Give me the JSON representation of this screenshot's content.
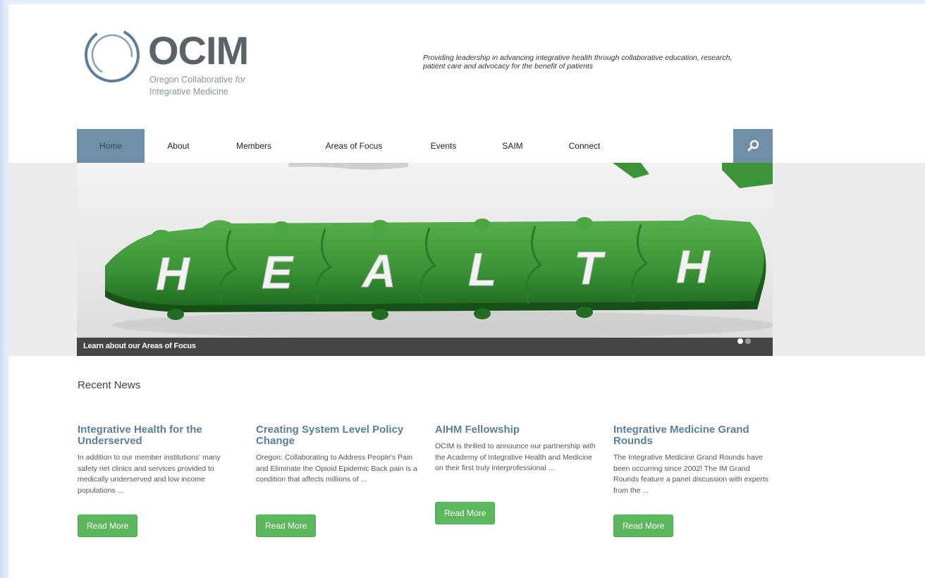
{
  "logo": {
    "mark": "OCIM",
    "line1": "Oregon Collaborative ",
    "line1_italic": "for",
    "line2": "Integrative Medicine"
  },
  "tagline": "Providing leadership in advancing integrative health through collaborative education, research, patient care and advocacy for the benefit of patients",
  "nav": {
    "items": [
      "Home",
      "About",
      "Members",
      "Areas of Focus",
      "Events",
      "SAIM",
      "Connect"
    ],
    "active": "Home",
    "search_icon": "search-icon"
  },
  "slider": {
    "letters": [
      "H",
      "E",
      "A",
      "L",
      "T",
      "H"
    ],
    "caption": "Learn about our Areas of Focus",
    "slide_count": 2,
    "current_slide": 1
  },
  "recent_news": {
    "heading": "Recent News",
    "items": [
      {
        "title": "Integrative Health for the Underserved",
        "excerpt": "In addition to our member institutions' many safety net clinics and services provided to medically underserved and low income populations ...",
        "button": "Read More"
      },
      {
        "title": "Creating System Level Policy Change",
        "excerpt": "Oregon: Collaborating to Address People's Pain and Eliminate the Opioid Epidemic Back pain is a condition that affects millions of ...",
        "button": "Read More"
      },
      {
        "title": "AIHM Fellowship",
        "excerpt": "OCIM is thrilled to announce our partnership with the Academy of Integrative Health and Medicine on their first truly interprofessional ...",
        "button": "Read More"
      },
      {
        "title": "Integrative Medicine Grand Rounds",
        "excerpt": "The Integrative Medicine Grand Rounds have been occurring since 2002! The IM Grand Rounds feature a panel discussion with experts from the ...",
        "button": "Read More"
      }
    ]
  },
  "colors": {
    "nav_active": "#6f8fa6",
    "news_title": "#5b7f9a",
    "button": "#5cb85c",
    "puzzle_green": "#3f9a3a"
  }
}
